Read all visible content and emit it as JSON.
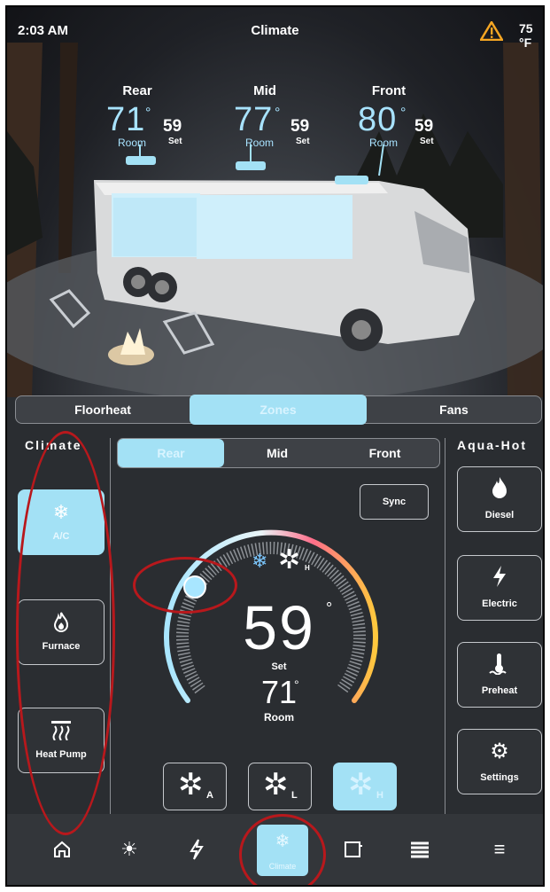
{
  "status": {
    "time": "2:03 AM",
    "title": "Climate",
    "outside_temp": "75 °F"
  },
  "zones_summary": [
    {
      "name": "Rear",
      "room": "71",
      "room_label": "Room",
      "set": "59",
      "set_label": "Set"
    },
    {
      "name": "Mid",
      "room": "77",
      "room_label": "Room",
      "set": "59",
      "set_label": "Set"
    },
    {
      "name": "Front",
      "room": "80",
      "room_label": "Room",
      "set": "59",
      "set_label": "Set"
    }
  ],
  "main_tabs": [
    "Floorheat",
    "Zones",
    "Fans"
  ],
  "climate_label": "Climate",
  "aqua_label": "Aqua-Hot",
  "zone_tabs": [
    "Rear",
    "Mid",
    "Front"
  ],
  "sync_label": "Sync",
  "modes": [
    {
      "label": "A/C",
      "icon": "snowflake-icon"
    },
    {
      "label": "Furnace",
      "icon": "flame-icon"
    },
    {
      "label": "Heat Pump",
      "icon": "heat-pump-icon"
    }
  ],
  "aqua": [
    {
      "label": "Diesel",
      "icon": "flame-icon"
    },
    {
      "label": "Electric",
      "icon": "bolt-icon"
    },
    {
      "label": "Preheat",
      "icon": "thermometer-icon"
    },
    {
      "label": "Settings",
      "icon": "gear-icon"
    }
  ],
  "dial": {
    "set": "59",
    "set_label": "Set",
    "room": "71",
    "room_label": "Room",
    "fan_speed": "H"
  },
  "fan_buttons": [
    {
      "sub": "A",
      "icon": "fan-auto-icon"
    },
    {
      "sub": "L",
      "icon": "fan-low-icon"
    },
    {
      "sub": "H",
      "icon": "fan-high-icon"
    }
  ],
  "nav": {
    "active_label": "Climate"
  },
  "colors": {
    "accent": "#a3e1f5",
    "panel": "#2a2d31",
    "annotation": "#b8181c"
  }
}
